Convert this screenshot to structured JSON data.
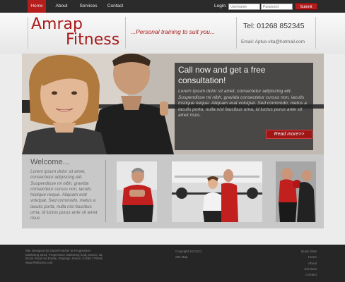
{
  "nav": {
    "items": [
      "Home",
      "About",
      "Services",
      "Contact"
    ]
  },
  "login": {
    "label": "Login:",
    "username_placeholder": "Username",
    "password_placeholder": "Password",
    "submit_label": "Submit"
  },
  "header": {
    "logo_line1": "Amrap",
    "logo_line2": "Fitness",
    "tagline": "...Personal training to suit you...",
    "phone": "Tel: 01268 852345",
    "email": "Email: Aptus-vita@hotmail.com"
  },
  "hero": {
    "title": "Call now and get a free consultation!",
    "body": "Lorem ipsum dolor sit amet, consectetur adipiscing elit. Suspendisse mi nibh, gravida consectetur cursus non, iaculis tristique neque. Aliquam erat volutpat. Sed commodo, metus a iaculis porta, nulla nisl faucibus urna, id luctus purus ante sit amet risus.",
    "read_more": "Read more>>"
  },
  "welcome": {
    "title": "Welcome...",
    "body": "Lorem ipsum dolor sit amet, consectetur adipiscing elit. Suspendisse mi nibh, gravida consectetur cursus non, iaculis tristique neque. Aliquam erat volutpat. Sed commodo, metus a iaculis porta, nulla nisl faucibus urna, id luctus purus ante sit amet risus."
  },
  "footer": {
    "credits": "Site Designed by Daniel Fulcher at Progressive Marketing 2013, Progressive Marketing (Ltd), Essex, 2a, Brook Road Ind Estate, Rayleigh, Essex. 01268 770944, www.PMEssex.com",
    "copyright": "Copyright 2013 (C)",
    "site_map": "Site Map",
    "links": [
      "Quick links",
      "Home",
      "About",
      "Services",
      "Contact"
    ]
  },
  "colors": {
    "accent": "#b51c1c",
    "topbar": "#2b2b2b",
    "footer": "#262626"
  }
}
